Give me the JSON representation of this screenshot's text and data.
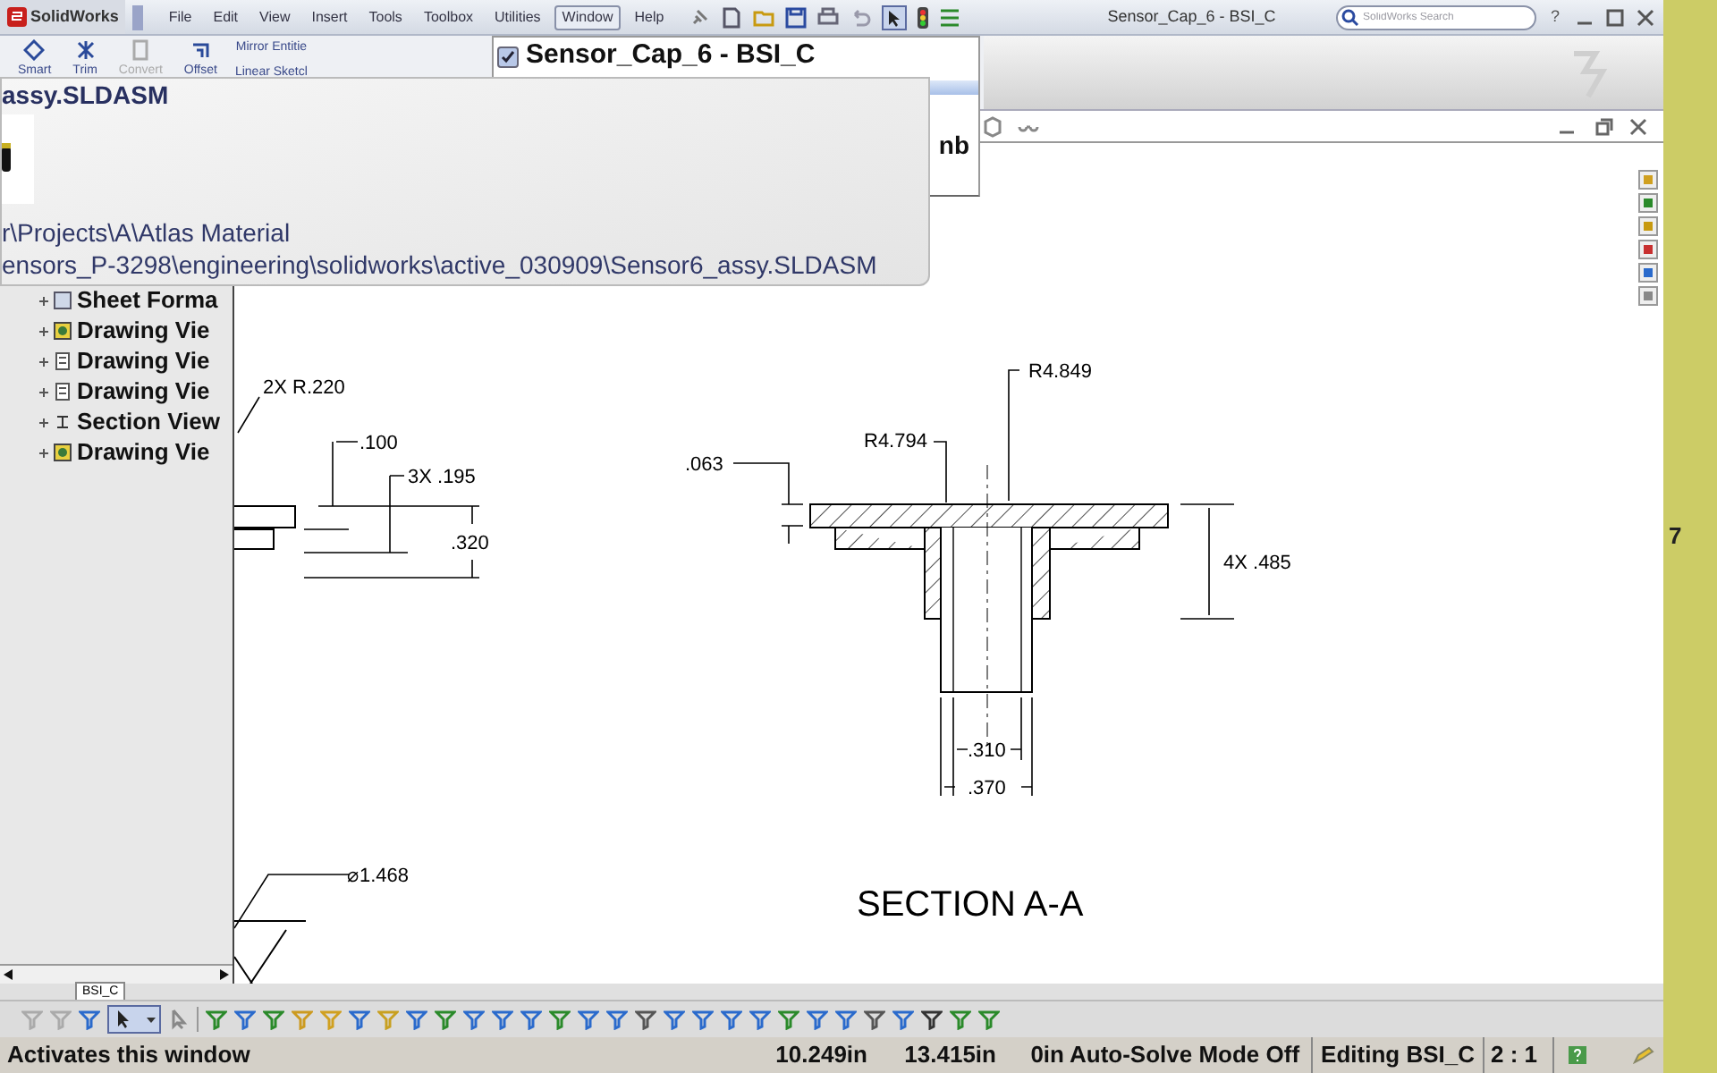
{
  "menu_bar": {
    "logo": "SolidWorks",
    "menus": [
      {
        "label": "File",
        "selected": false
      },
      {
        "label": "Edit",
        "selected": false
      },
      {
        "label": "View",
        "selected": false
      },
      {
        "label": "Insert",
        "selected": false
      },
      {
        "label": "Tools",
        "selected": false
      },
      {
        "label": "Toolbox",
        "selected": false
      },
      {
        "label": "Utilities",
        "selected": false
      },
      {
        "label": "Window",
        "selected": true
      },
      {
        "label": "Help",
        "selected": false
      }
    ]
  },
  "title_bar": {
    "title": "Sensor_Cap_6 - BSI_C",
    "search": {
      "placeholder": "SolidWorks Search"
    },
    "help": "?"
  },
  "command_manager": {
    "tools": [
      {
        "label": "Smart",
        "disabled": false
      },
      {
        "label": "Trim",
        "disabled": false
      },
      {
        "label": "Convert",
        "disabled": true
      },
      {
        "label": "Offset",
        "disabled": false
      }
    ],
    "small_tools": [
      "Mirror Entitie",
      "Linear Sketcl"
    ]
  },
  "window_list": {
    "items": [
      {
        "title": "Sensor_Cap_6 - BSI_C",
        "checked": true
      }
    ],
    "behind_text": "nb"
  },
  "tooltip": {
    "title": "assy.SLDASM",
    "path_lines": [
      "r\\Projects\\A\\Atlas Material",
      "ensors_P-3298\\engineering\\solidworks\\active_030909\\Sensor6_assy.SLDASM"
    ]
  },
  "feature_tree": {
    "items": [
      {
        "label": "Sheet Forma",
        "kind": "sheet"
      },
      {
        "label": "Drawing Vie",
        "kind": "model"
      },
      {
        "label": "Drawing Vie",
        "kind": "doc"
      },
      {
        "label": "Drawing Vie",
        "kind": "doc"
      },
      {
        "label": "Section View",
        "kind": "section"
      },
      {
        "label": "Drawing Vie",
        "kind": "model"
      }
    ]
  },
  "sheet_tabs": [
    {
      "label": "BSI_C",
      "selected": true
    }
  ],
  "drawing": {
    "side_dimensions": [
      "2X R.220",
      ".100",
      "3X .195",
      ".320",
      "⌀1.468"
    ],
    "section_dimensions": [
      ".063",
      "R4.794",
      "R4.849",
      "4X .485",
      ".310",
      ".370"
    ],
    "section_title": "SECTION A-A"
  },
  "status_bar": {
    "message": "Activates this window",
    "x": "10.249in",
    "y": "13.415in",
    "z": "0in",
    "solve_mode": "Auto-Solve Mode Off",
    "editing": "Editing BSI_C",
    "scale": "2 : 1"
  },
  "side_strip": {
    "text": "7"
  }
}
